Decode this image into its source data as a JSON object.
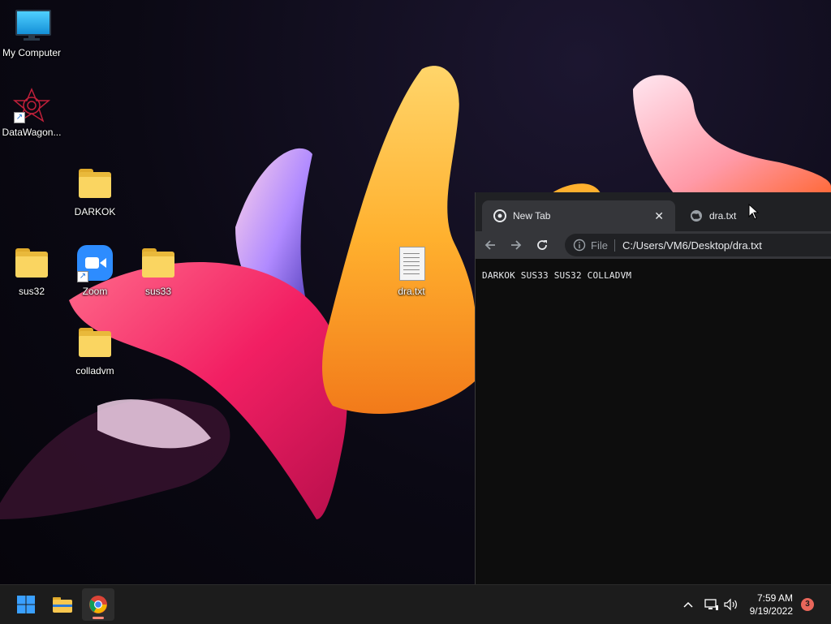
{
  "desktop": {
    "icons": [
      {
        "label": "My Computer",
        "icon": "monitor-icon"
      },
      {
        "label": "DataWagon...",
        "icon": "datawagon-icon"
      },
      {
        "label": "DARKOK",
        "icon": "folder-icon"
      },
      {
        "label": "sus32",
        "icon": "folder-icon"
      },
      {
        "label": "Zoom",
        "icon": "zoom-icon"
      },
      {
        "label": "sus33",
        "icon": "folder-icon"
      },
      {
        "label": "dra.txt",
        "icon": "text-file-icon"
      },
      {
        "label": "colladvm",
        "icon": "folder-icon"
      }
    ]
  },
  "browser": {
    "tabs": [
      {
        "title": "New Tab",
        "icon": "chrome-icon",
        "active": true
      },
      {
        "title": "dra.txt",
        "icon": "globe-icon",
        "active": false
      }
    ],
    "close_glyph": "✕",
    "address": {
      "scheme_label": "File",
      "url": "C:/Users/VM6/Desktop/dra.txt"
    },
    "page_text": "DARKOK SUS33 SUS32 COLLADVM"
  },
  "taskbar": {
    "apps": [
      {
        "name": "start",
        "icon": "windows-start-icon"
      },
      {
        "name": "file-explorer",
        "icon": "file-explorer-icon"
      },
      {
        "name": "chrome",
        "icon": "chrome-icon",
        "active": true
      }
    ],
    "tray": {
      "time": "7:59 AM",
      "date": "9/19/2022",
      "notification_count": "3"
    }
  },
  "colors": {
    "taskbar_bg": "#1c1c1c",
    "tab_active_bg": "#35363a",
    "tabstrip_bg": "#202124",
    "badge": "#e8665a"
  }
}
